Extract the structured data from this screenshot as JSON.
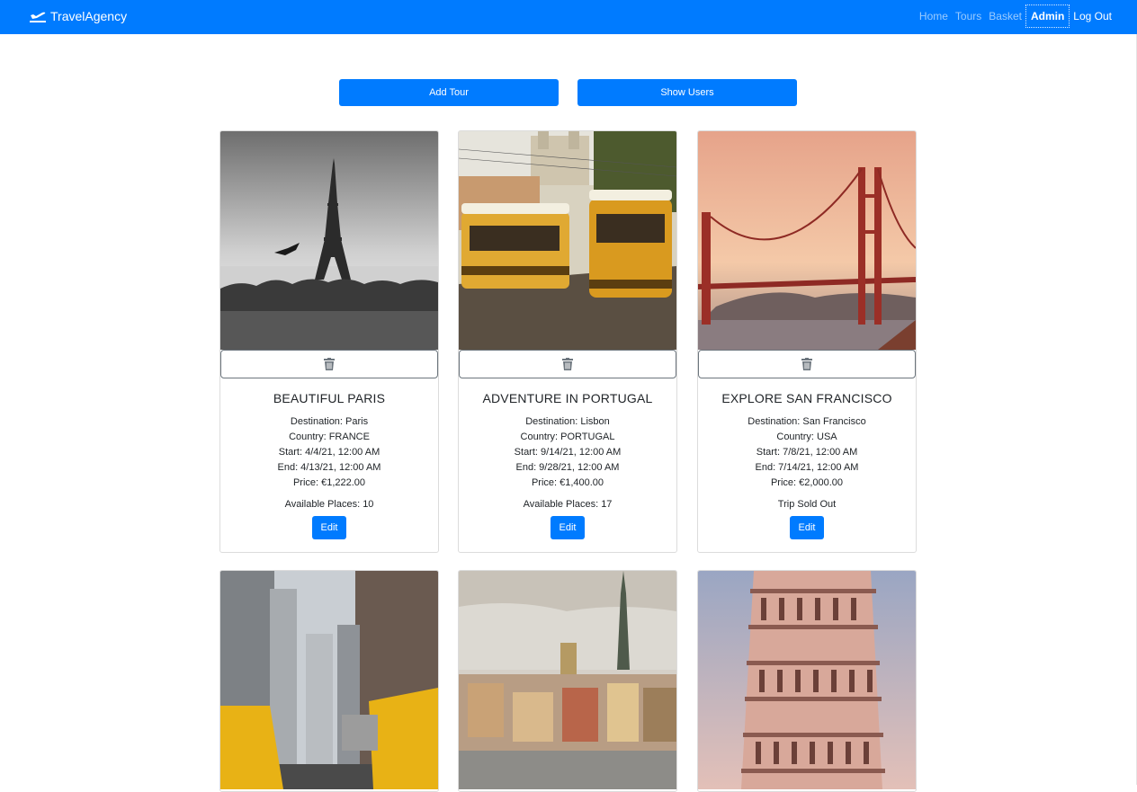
{
  "nav": {
    "brand": "TravelAgency",
    "links": [
      "Home",
      "Tours",
      "Basket",
      "Admin",
      "Log Out"
    ]
  },
  "actions": {
    "add_tour": "Add Tour",
    "show_users": "Show Users"
  },
  "tours": [
    {
      "title": "BEAUTIFUL PARIS",
      "destination": "Destination: Paris",
      "country": "Country: FRANCE",
      "start": "Start: 4/4/21, 12:00 AM",
      "end": "End: 4/13/21, 12:00 AM",
      "price": "Price: €1,222.00",
      "availability": "Available Places: 10",
      "edit": "Edit"
    },
    {
      "title": "ADVENTURE IN PORTUGAL",
      "destination": "Destination: Lisbon",
      "country": "Country: PORTUGAL",
      "start": "Start: 9/14/21, 12:00 AM",
      "end": "End: 9/28/21, 12:00 AM",
      "price": "Price: €1,400.00",
      "availability": "Available Places: 17",
      "edit": "Edit"
    },
    {
      "title": "EXPLORE SAN FRANCISCO",
      "destination": "Destination: San Francisco",
      "country": "Country: USA",
      "start": "Start: 7/8/21, 12:00 AM",
      "end": "End: 7/14/21, 12:00 AM",
      "price": "Price: €2,000.00",
      "availability": "Trip Sold Out",
      "edit": "Edit"
    }
  ],
  "colors": {
    "primary": "#007bff",
    "border": "#dcdcdc"
  }
}
